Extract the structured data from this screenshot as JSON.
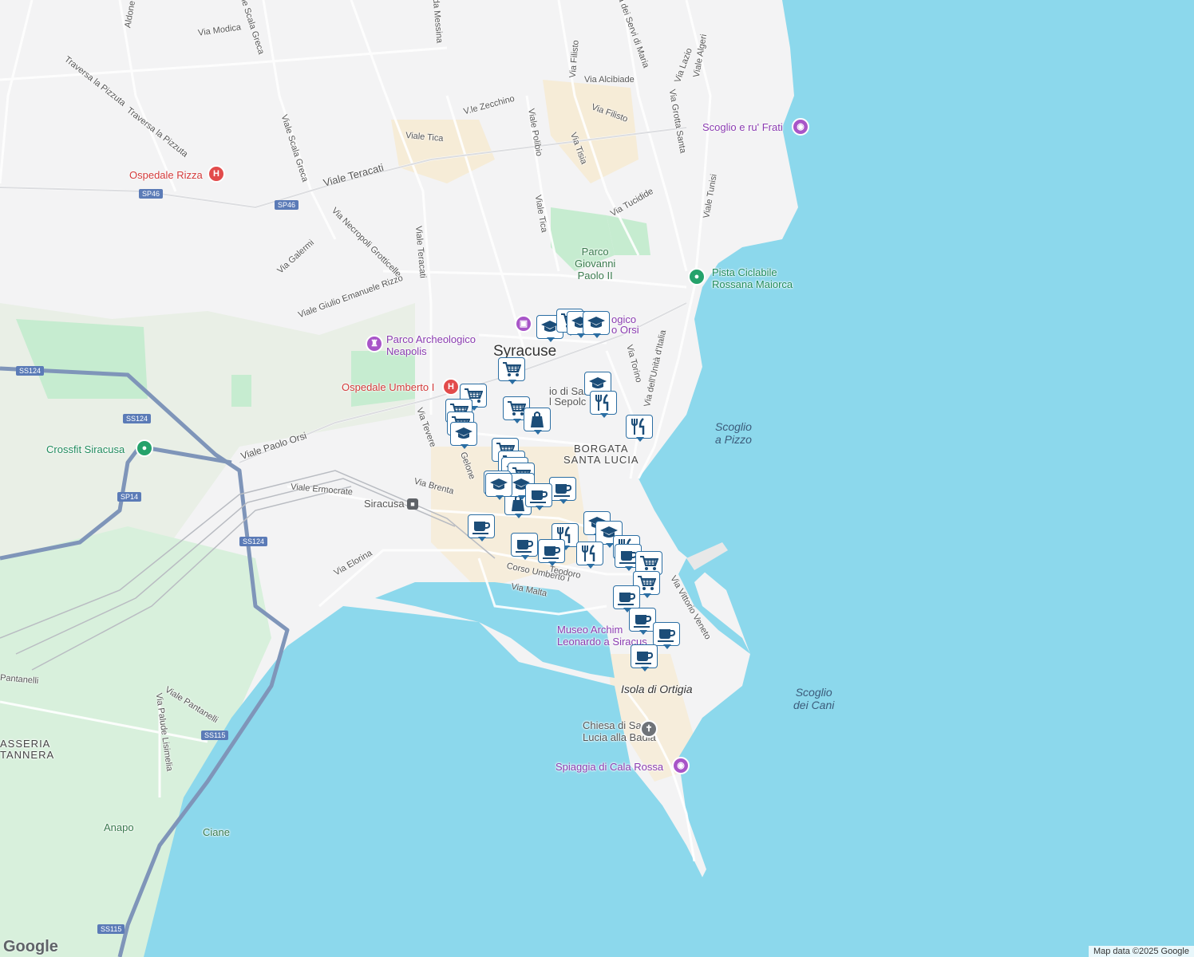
{
  "map": {
    "colors": {
      "water": "#8cd8ec",
      "land": "#f3f3f4",
      "park": "#c6ecd0",
      "highway": "#7f95b9",
      "marker_border": "#2b6ea3",
      "marker_icon": "#1c4d78"
    },
    "labels": {
      "city": "Syracuse",
      "district": "BORGATA\nSANTA LUCIA",
      "island": "Isola di Ortigia",
      "water1": "Scoglio\na Pizzo",
      "water2": "Scoglio\ndei Cani",
      "station": "Siracusa",
      "park1": "Parco\nGiovanni\nPaolo II",
      "hospital1": "Ospedale Rizza",
      "hospital2": "Ospedale Umberto I",
      "poi1": "Parco Archeologico\nNeapolis",
      "poi2": "Scoglio e ru' Frati",
      "poi3": "Pista Ciclabile\nRossana Maiorca",
      "poi4": "Crossfit Siracusa",
      "poi5": "Museo Archim\nLeonardo a Siracus",
      "poi6": "Chiesa di Santa\nLucia alla Badia",
      "poi7": "Spiaggia di Cala Rossa",
      "poi8": "ogico\no Orsi",
      "poi9": "io di San\nl Sepolc",
      "anapo": "Anapo",
      "ciane": "Ciane",
      "masseria": "ASSERIA\nTANNERA"
    },
    "streets": [
      "Aldone",
      "Via Modica",
      "Viale Scala Greca",
      "Traversa la Pizzuta",
      "Traversa la Pizzuta",
      "Viale Scala Greca",
      "Viale Teracati",
      "Via Necropoli Grotticelle",
      "Via Galermi",
      "Viale Giulio Emanuele Rizzo",
      "Viale Teracati",
      "Viale Tica",
      "V.le Zecchino",
      "Viale Polibio",
      "Via Tisia",
      "Via Filisto",
      "Via Filisto",
      "Via Alcibiade",
      "Via dei Servi di Maria",
      "Viale Tica",
      "Via Tucidide",
      "Via Grotta Santa",
      "Via Lazio",
      "Viale Algeri",
      "Viale Tunisi",
      "Via Torino",
      "Via dell'Unità d'Italia",
      "Viale Paolo Orsi",
      "Viale Ermocrate",
      "Via Brenta",
      "Via Tevere",
      "Via Elorina",
      "Corso Umberto I",
      "Via Malta",
      "Via Vittorio Veneto",
      "Viale Pantanelli",
      "Via Palude Lisimelia",
      "Pantanelli",
      "da Messina",
      "Via Filisto",
      "Gelone",
      "Teodoro"
    ],
    "shields": [
      "SP46",
      "SP46",
      "SS124",
      "SS124",
      "SP14",
      "SS124",
      "SS115",
      "SS115"
    ],
    "markers": [
      "education",
      "shopping-cart",
      "education",
      "education",
      "shopping-cart",
      "shopping-cart",
      "education",
      "restaurant",
      "shopping-cart",
      "shopping-bag",
      "shopping-cart",
      "shopping-cart",
      "restaurant",
      "education",
      "shopping-cart",
      "shopping-cart",
      "education",
      "shopping-cart",
      "education",
      "shopping-bag",
      "coffee",
      "education",
      "coffee",
      "coffee",
      "restaurant",
      "education",
      "education",
      "restaurant",
      "coffee",
      "restaurant",
      "coffee",
      "shopping-cart",
      "shopping-cart",
      "coffee",
      "coffee",
      "coffee",
      "coffee",
      "coffee",
      "education"
    ],
    "logo": "Google",
    "attribution": "Map data ©2025 Google"
  }
}
